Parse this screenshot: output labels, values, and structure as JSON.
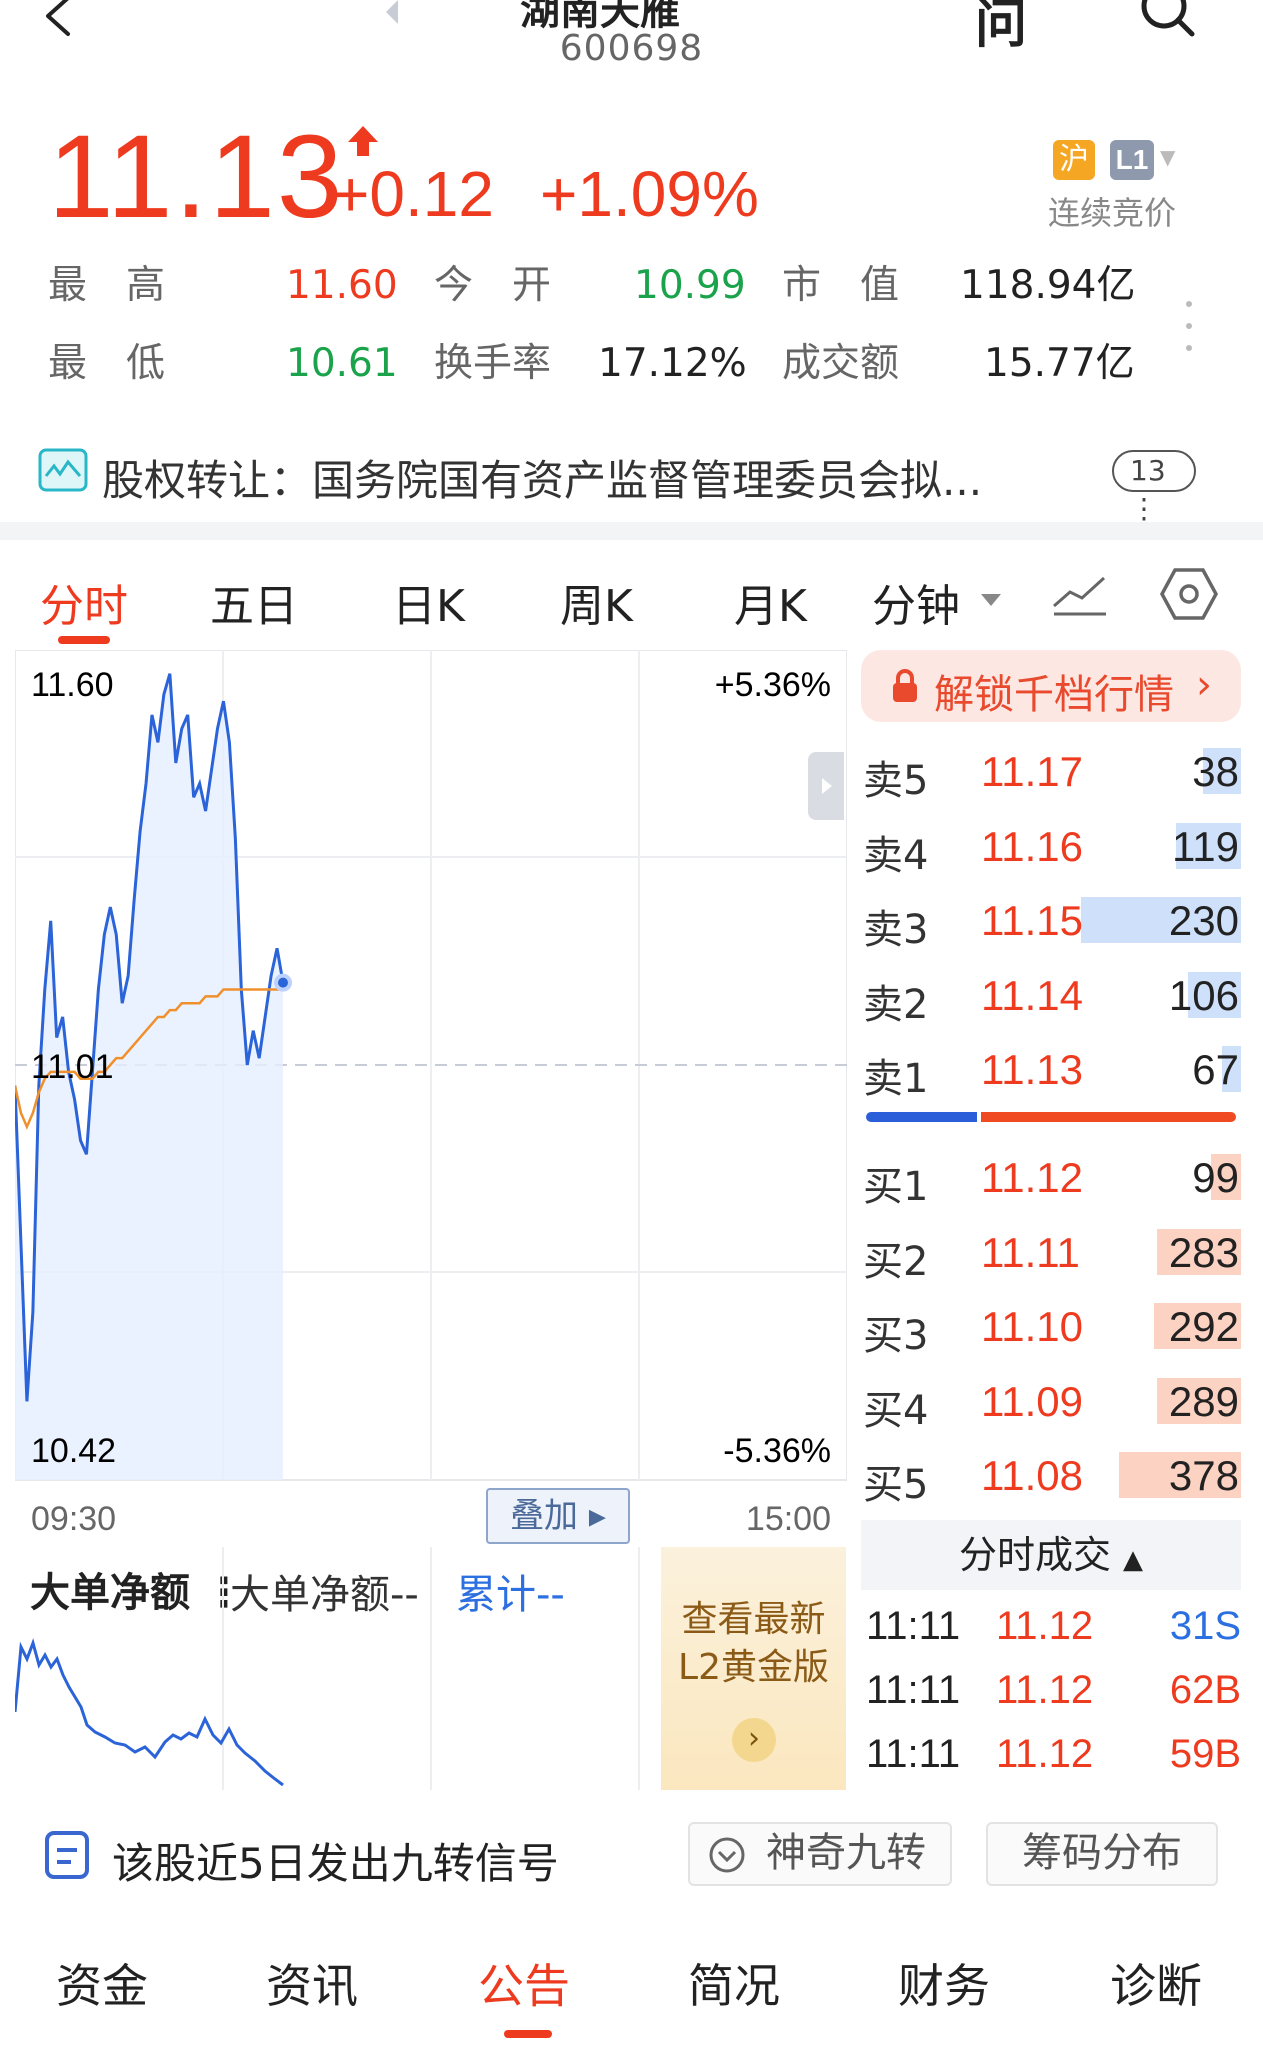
{
  "header": {
    "title": "湖南天雁",
    "code": "600698",
    "ask_label": "问"
  },
  "quote": {
    "price": "11.13",
    "change": "+0.12",
    "change_pct": "+1.09%",
    "market_tag": "沪",
    "level_tag": "L1",
    "trade_state": "连续竞价"
  },
  "stats": {
    "high_label": "最　高",
    "high": "11.60",
    "open_label": "今　开",
    "open": "10.99",
    "mcap_label": "市　值",
    "mcap": "118.94亿",
    "low_label": "最　低",
    "low": "10.61",
    "turnover_label": "换手率",
    "turnover": "17.12%",
    "amount_label": "成交额",
    "amount": "15.77亿"
  },
  "news": {
    "text": "股权转让：国务院国有资产监督管理委员会拟...",
    "count": "13"
  },
  "chart_tabs": [
    "分时",
    "五日",
    "日K",
    "周K",
    "月K",
    "分钟"
  ],
  "chart": {
    "y_top": "11.60",
    "y_mid": "11.01",
    "y_bottom": "10.42",
    "pct_top": "+5.36%",
    "pct_bottom": "-5.36%",
    "time_start": "09:30",
    "time_end": "15:00",
    "overlay_label": "叠加"
  },
  "chart_data": {
    "type": "line",
    "x_range": [
      "09:30",
      "15:00"
    ],
    "ylim": [
      10.42,
      11.6
    ],
    "prev_close": 11.01,
    "series": [
      {
        "values": [
          10.98,
          10.75,
          10.52,
          10.65,
          10.98,
          11.12,
          11.22,
          11.05,
          11.08,
          11.0,
          10.96,
          10.9,
          10.88,
          11.0,
          11.12,
          11.2,
          11.24,
          11.2,
          11.1,
          11.14,
          11.25,
          11.35,
          11.42,
          11.52,
          11.48,
          11.55,
          11.58,
          11.45,
          11.5,
          11.52,
          11.4,
          11.42,
          11.38,
          11.44,
          11.5,
          11.54,
          11.48,
          11.34,
          11.12,
          11.01,
          11.06,
          11.02,
          11.08,
          11.14,
          11.18,
          11.13
        ]
      },
      {
        "values": [
          10.98,
          10.94,
          10.92,
          10.94,
          10.97,
          10.99,
          11.0,
          11.0,
          11.0,
          11.0,
          11.0,
          10.99,
          10.99,
          10.99,
          11.0,
          11.0,
          11.01,
          11.02,
          11.02,
          11.03,
          11.04,
          11.05,
          11.06,
          11.07,
          11.08,
          11.08,
          11.09,
          11.09,
          11.1,
          11.1,
          11.1,
          11.1,
          11.11,
          11.11,
          11.11,
          11.12,
          11.12,
          11.12,
          11.12,
          11.12,
          11.12,
          11.12,
          11.12,
          11.12,
          11.12,
          11.12
        ]
      }
    ]
  },
  "order_book": {
    "unlock_label": "解锁千档行情",
    "asks": [
      {
        "side": "卖5",
        "price": "11.17",
        "vol": "38",
        "fill": 0.1
      },
      {
        "side": "卖4",
        "price": "11.16",
        "vol": "119",
        "fill": 0.17
      },
      {
        "side": "卖3",
        "price": "11.15",
        "vol": "230",
        "fill": 0.42
      },
      {
        "side": "卖2",
        "price": "11.14",
        "vol": "106",
        "fill": 0.14
      },
      {
        "side": "卖1",
        "price": "11.13",
        "vol": "67",
        "fill": 0.05
      }
    ],
    "bids": [
      {
        "side": "买1",
        "price": "11.12",
        "vol": "99",
        "fill": 0.08
      },
      {
        "side": "买2",
        "price": "11.11",
        "vol": "283",
        "fill": 0.22
      },
      {
        "side": "买3",
        "price": "11.10",
        "vol": "292",
        "fill": 0.23
      },
      {
        "side": "买4",
        "price": "11.09",
        "vol": "289",
        "fill": 0.22
      },
      {
        "side": "买5",
        "price": "11.08",
        "vol": "378",
        "fill": 0.32
      }
    ],
    "buy_ratio": 0.3
  },
  "ticks": {
    "header": "分时成交",
    "rows": [
      {
        "time": "11:11",
        "price": "11.12",
        "vol": "31S"
      },
      {
        "time": "11:11",
        "price": "11.12",
        "vol": "62B"
      },
      {
        "time": "11:11",
        "price": "11.12",
        "vol": "59B"
      }
    ]
  },
  "big_order": {
    "title": "大单净额",
    "sub": "大单净额--",
    "cum": "累计--",
    "promo": "查看最新L2黄金版"
  },
  "signal": {
    "text": "该股近5日发出九转信号",
    "magic_label": "神奇九转",
    "chip_label": "筹码分布"
  },
  "bottom_tabs": [
    "资金",
    "资讯",
    "公告",
    "简况",
    "财务",
    "诊断"
  ],
  "colors": {
    "up": "#ee3b1f",
    "down": "#1aa34a",
    "accent_blue": "#2b6fe0"
  }
}
